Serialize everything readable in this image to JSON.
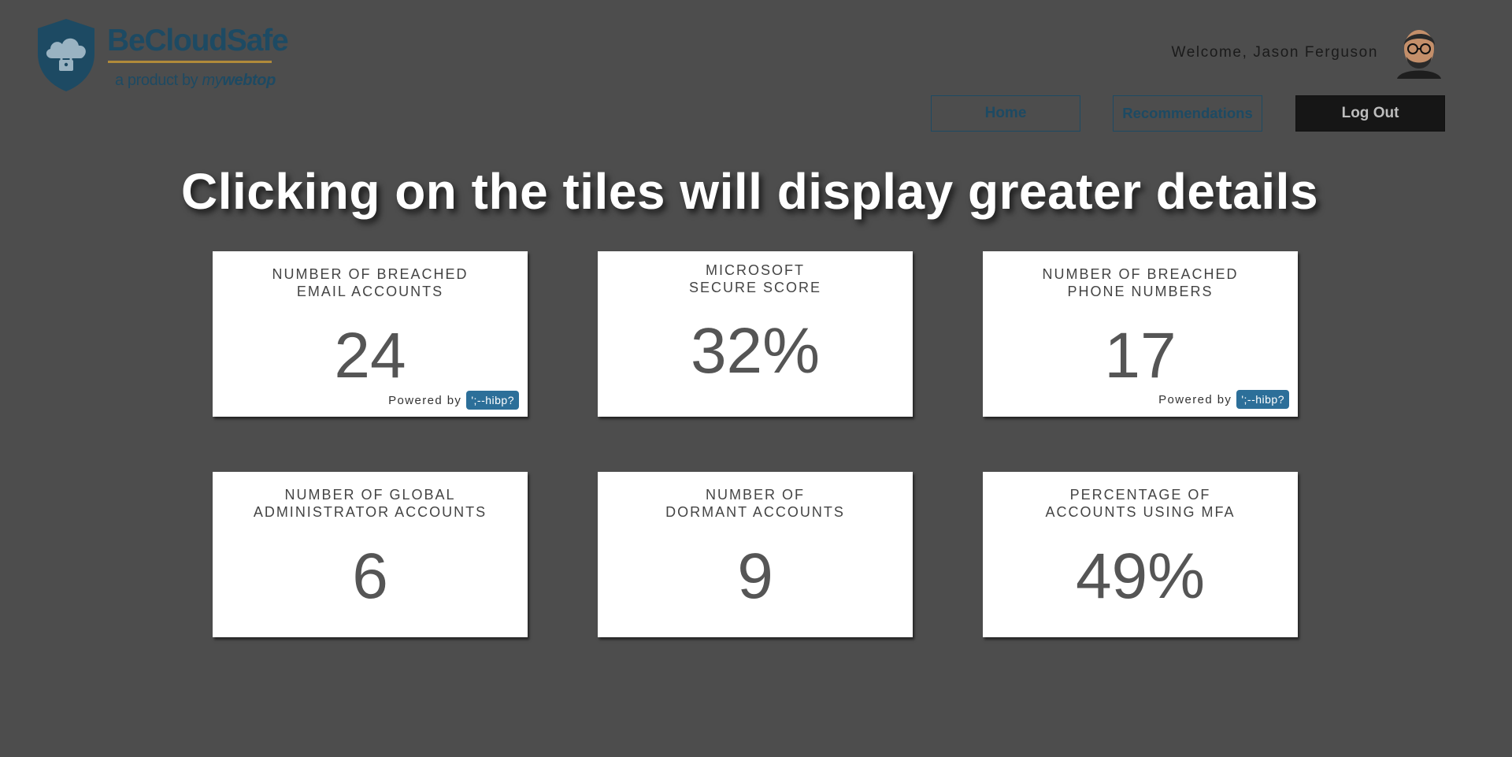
{
  "brand": {
    "name": "BeCloudSafe",
    "tagline_prefix": "a product by",
    "tagline_brand_a": "my",
    "tagline_brand_b": "webtop"
  },
  "header": {
    "welcome": "Welcome, Jason Ferguson",
    "nav": {
      "home": "Home",
      "recommendations": "Recommendations",
      "logout": "Log Out"
    }
  },
  "headline": "Clicking on the tiles will display greater details",
  "tiles": [
    {
      "title_line1": "NUMBER OF BREACHED",
      "title_line2": "EMAIL ACCOUNTS",
      "value": "24",
      "powered_by": "Powered by",
      "badge": "';--hibp?"
    },
    {
      "title_line1": "MICROSOFT",
      "title_line2": "SECURE SCORE",
      "value": "32%"
    },
    {
      "title_line1": "NUMBER OF BREACHED",
      "title_line2": "PHONE NUMBERS",
      "value": "17",
      "powered_by": "Powered by",
      "badge": "';--hibp?"
    },
    {
      "title_line1": "NUMBER OF GLOBAL",
      "title_line2": "ADMINISTRATOR ACCOUNTS",
      "value": "6"
    },
    {
      "title_line1": "NUMBER OF",
      "title_line2": "DORMANT ACCOUNTS",
      "value": "9"
    },
    {
      "title_line1": "PERCENTAGE OF",
      "title_line2": "ACCOUNTS USING MFA",
      "value": "49%"
    }
  ],
  "colors": {
    "background": "#4d4d4d",
    "brand": "#1d4a63",
    "accent": "#b08a3a",
    "hibp_badge": "#2c6f99",
    "logout_bg": "#161616"
  },
  "icons": {
    "logo": "shield-cloud-lock-icon",
    "avatar": "user-avatar"
  }
}
